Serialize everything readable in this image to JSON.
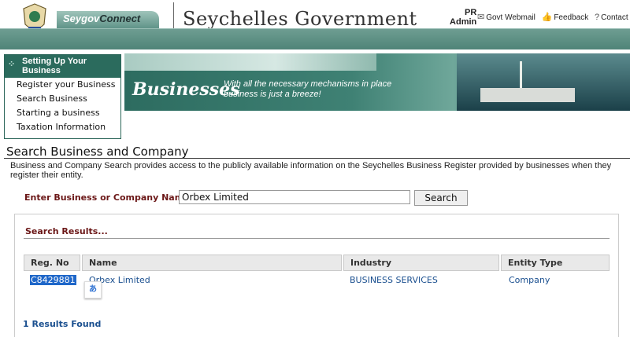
{
  "header": {
    "brand_part1": "Seygov",
    "brand_part2": "Connect",
    "title": "Seychelles Government",
    "user_initials": "PR",
    "user_role": "Admin",
    "links": [
      {
        "icon": "mail-icon",
        "label": "Govt Webmail"
      },
      {
        "icon": "thumbs-up-icon",
        "label": "Feedback"
      },
      {
        "icon": "help-icon",
        "label": "Contact Us"
      }
    ]
  },
  "sidebar": {
    "heading": "Setting Up Your Business",
    "items": [
      {
        "label": "Register your Business"
      },
      {
        "label": "Search Business"
      },
      {
        "label": "Starting a business"
      },
      {
        "label": "Taxation Information"
      }
    ]
  },
  "banner": {
    "title": "Businesses",
    "subtitle_line1": "With all the necessary mechanisms in place",
    "subtitle_line2": "business is just a breeze!"
  },
  "page": {
    "title": "Search Business and Company",
    "description": "Business and Company Search provides access to the publicly available information on the Seychelles Business Register provided by businesses when they register their entity."
  },
  "search": {
    "label": "Enter Business or Company Name",
    "value": "Orbex Limited",
    "button_label": "Search"
  },
  "results": {
    "heading": "Search Results...",
    "columns": [
      "Reg. No",
      "Name",
      "Industry",
      "Entity Type"
    ],
    "rows": [
      {
        "reg_no": "C8429881",
        "name": "Orbex Limited",
        "industry": "BUSINESS SERVICES",
        "entity_type": "Company"
      }
    ],
    "count_text": "1 Results Found"
  },
  "colors": {
    "header_green": "#4f8478",
    "sidebar_green": "#2b6b5d",
    "label_maroon": "#6b1717",
    "link_blue": "#1a4f8f",
    "selection_blue": "#1f67c9"
  }
}
